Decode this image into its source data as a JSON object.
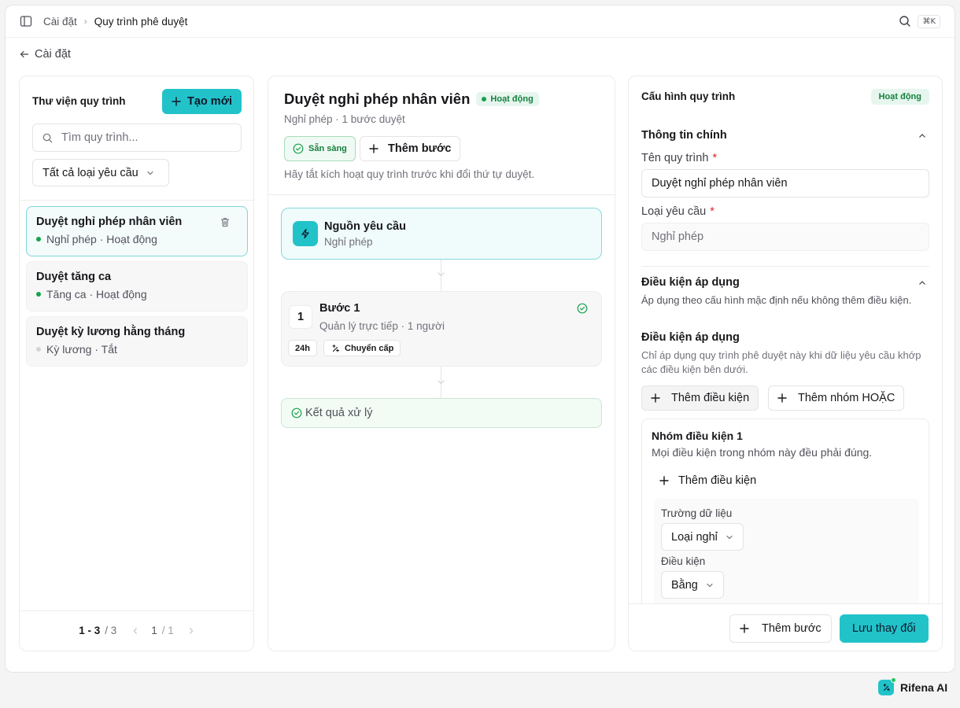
{
  "topbar": {
    "crumb_parent": "Cài đặt",
    "crumb_current": "Quy trình phê duyệt",
    "shortcut": "⌘K"
  },
  "back_label": "Cài đặt",
  "library": {
    "title": "Thư viện quy trình",
    "create_label": "Tạo mới",
    "search_placeholder": "Tìm quy trình...",
    "filter_value": "Tất cả loại yêu cầu",
    "items": [
      {
        "name": "Duyệt nghỉ phép nhân viên",
        "meta": "Nghỉ phép · Hoạt động",
        "status_color": "#16a34a"
      },
      {
        "name": "Duyệt tăng ca",
        "meta": "Tăng ca · Hoạt động",
        "status_color": "#16a34a"
      },
      {
        "name": "Duyệt kỳ lương hằng tháng",
        "meta": "Kỳ lương · Tắt",
        "status_color": "#d4d4d8"
      }
    ],
    "pagination": {
      "range": "1 - 3",
      "total": "/ 3",
      "page": "1",
      "pages": "/ 1"
    }
  },
  "workflow": {
    "title": "Duyệt nghỉ phép nhân viên",
    "status": "Hoạt động",
    "subtitle": "Nghỉ phép · 1 bước duyệt",
    "ready_label": "Sẵn sàng",
    "add_step_label": "Thêm bước",
    "hint": "Hãy tắt kích hoạt quy trình trước khi đổi thứ tự duyệt.",
    "source": {
      "title": "Nguồn yêu cầu",
      "subtitle": "Nghỉ phép"
    },
    "step": {
      "number": "1",
      "title": "Bước 1",
      "subtitle": "Quản lý trực tiếp · 1 người",
      "sla": "24h",
      "escalate": "Chuyển cấp"
    },
    "result_label": "Kết quả xử lý"
  },
  "config": {
    "title": "Cấu hình quy trình",
    "status": "Hoạt động",
    "main_section": "Thông tin chính",
    "name_label": "Tên quy trình",
    "name_value": "Duyệt nghỉ phép nhân viên",
    "type_label": "Loại yêu cầu",
    "type_value": "Nghỉ phép",
    "conditions_section": "Điều kiện áp dụng",
    "conditions_desc": "Áp dụng theo cấu hình mặc định nếu không thêm điều kiện.",
    "conditions_sub": "Điều kiện áp dụng",
    "conditions_sub_desc": "Chỉ áp dụng quy trình phê duyệt này khi dữ liệu yêu cầu khớp các điều kiện bên dưới.",
    "add_condition_label": "Thêm điều kiện",
    "add_or_group_label": "Thêm nhóm HOẶC",
    "group": {
      "title": "Nhóm điều kiện 1",
      "desc": "Mọi điều kiện trong nhóm này đều phải đúng.",
      "add_condition_label": "Thêm điều kiện",
      "field_label": "Trường dữ liệu",
      "field_value": "Loại nghỉ",
      "operator_label": "Điều kiện",
      "operator_value": "Bằng"
    },
    "footer": {
      "add_step_label": "Thêm bước",
      "save_label": "Lưu thay đổi"
    }
  },
  "assistant_label": "Rifena AI",
  "colors": {
    "accent": "#21c3c9",
    "active": "#16a34a",
    "active_bg": "#e6f6ee"
  }
}
